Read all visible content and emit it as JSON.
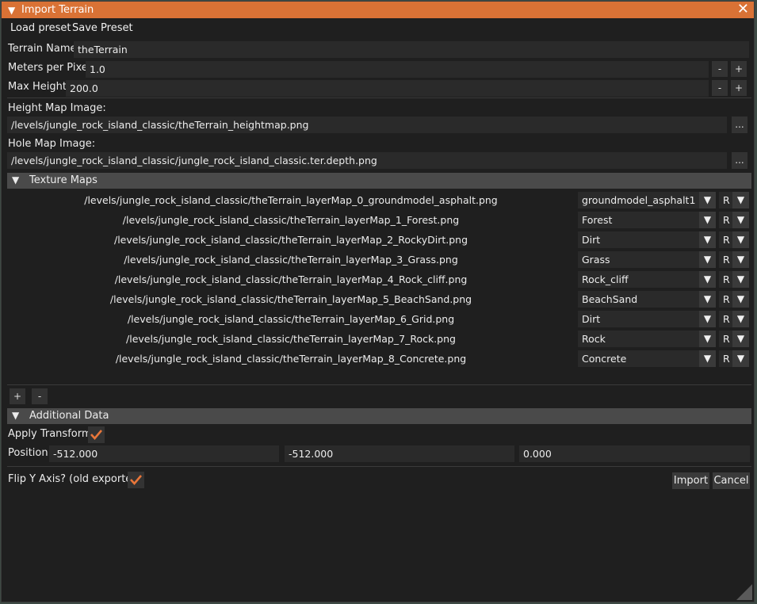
{
  "window": {
    "title": "Import Terrain",
    "close_glyph": "✕"
  },
  "menu": {
    "load": "Load preset",
    "save": "Save Preset"
  },
  "fields": {
    "terrain_name": {
      "label": "Terrain Name",
      "value": "theTerrain"
    },
    "meters_per_pixel": {
      "label": "Meters per Pixel",
      "value": "1.0"
    },
    "max_height": {
      "label": "Max Height",
      "value": "200.0"
    },
    "height_map": {
      "label": "Height Map Image:",
      "value": "/levels/jungle_rock_island_classic/theTerrain_heightmap.png"
    },
    "hole_map": {
      "label": "Hole Map Image:",
      "value": "/levels/jungle_rock_island_classic/jungle_rock_island_classic.ter.depth.png"
    }
  },
  "buttons": {
    "minus": "-",
    "plus": "+",
    "browse": "...",
    "import": "Import",
    "cancel": "Cancel"
  },
  "texture_maps": {
    "header": "Texture Maps",
    "rows": [
      {
        "path": "/levels/jungle_rock_island_classic/theTerrain_layerMap_0_groundmodel_asphalt.png",
        "material": "groundmodel_asphalt1",
        "channel": "R"
      },
      {
        "path": "/levels/jungle_rock_island_classic/theTerrain_layerMap_1_Forest.png",
        "material": "Forest",
        "channel": "R"
      },
      {
        "path": "/levels/jungle_rock_island_classic/theTerrain_layerMap_2_RockyDirt.png",
        "material": "Dirt",
        "channel": "R"
      },
      {
        "path": "/levels/jungle_rock_island_classic/theTerrain_layerMap_3_Grass.png",
        "material": "Grass",
        "channel": "R"
      },
      {
        "path": "/levels/jungle_rock_island_classic/theTerrain_layerMap_4_Rock_cliff.png",
        "material": "Rock_cliff",
        "channel": "R"
      },
      {
        "path": "/levels/jungle_rock_island_classic/theTerrain_layerMap_5_BeachSand.png",
        "material": "BeachSand",
        "channel": "R"
      },
      {
        "path": "/levels/jungle_rock_island_classic/theTerrain_layerMap_6_Grid.png",
        "material": "Dirt",
        "channel": "R"
      },
      {
        "path": "/levels/jungle_rock_island_classic/theTerrain_layerMap_7_Rock.png",
        "material": "Rock",
        "channel": "R"
      },
      {
        "path": "/levels/jungle_rock_island_classic/theTerrain_layerMap_8_Concrete.png",
        "material": "Concrete",
        "channel": "R"
      }
    ],
    "add": "+",
    "remove": "-"
  },
  "additional": {
    "header": "Additional Data",
    "apply_transform": {
      "label": "Apply Transform",
      "checked": true
    },
    "position": {
      "label": "Position",
      "x": "-512.000",
      "y": "-512.000",
      "z": "0.000"
    },
    "flip_y": {
      "label": "Flip Y Axis? (old exporter)",
      "checked": true
    }
  },
  "colors": {
    "accent": "#d97235",
    "check": "#e8763a",
    "panel": "#1f1f1f",
    "header": "#4a4a4a"
  }
}
